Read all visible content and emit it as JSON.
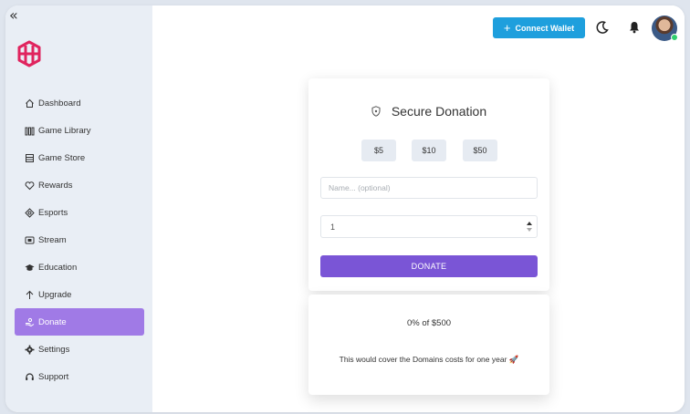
{
  "sidebar": {
    "collapse_glyph": "«",
    "logo_icon": "game-logo-icon",
    "items": [
      {
        "label": "Dashboard",
        "icon": "home-icon"
      },
      {
        "label": "Game Library",
        "icon": "library-icon"
      },
      {
        "label": "Game Store",
        "icon": "store-icon"
      },
      {
        "label": "Rewards",
        "icon": "heart-icon"
      },
      {
        "label": "Esports",
        "icon": "target-icon"
      },
      {
        "label": "Stream",
        "icon": "stream-icon"
      },
      {
        "label": "Education",
        "icon": "graduation-cap-icon"
      },
      {
        "label": "Upgrade",
        "icon": "arrow-up-icon"
      },
      {
        "label": "Donate",
        "icon": "donate-icon",
        "active": true
      },
      {
        "label": "Settings",
        "icon": "gear-icon"
      },
      {
        "label": "Support",
        "icon": "headset-icon"
      }
    ]
  },
  "header": {
    "connect_plus": "+",
    "connect_wallet_label": "Connect Wallet",
    "theme_icon": "moon-icon",
    "bell_icon": "bell-icon",
    "avatar_status": "online"
  },
  "donation": {
    "title": "Secure Donation",
    "title_icon": "shield-icon",
    "amounts": [
      "$5",
      "$10",
      "$50"
    ],
    "name_placeholder": "Name... (optional)",
    "name_value": "",
    "quantity_value": "1",
    "donate_label": "DONATE"
  },
  "progress": {
    "status_text": "0% of $500",
    "percent": 0,
    "goal": "$500",
    "cover_text": "This would cover the Domains costs for one year 🚀"
  },
  "colors": {
    "accent_purple": "#7a55d6",
    "active_nav": "#a07ae6",
    "connect_blue": "#1e9fdd",
    "online_green": "#2fcf6e"
  }
}
